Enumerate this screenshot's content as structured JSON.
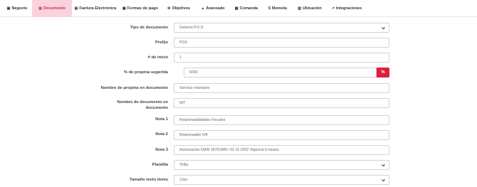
{
  "tabs": [
    {
      "icon": "▣",
      "label": "Negocio"
    },
    {
      "icon": "▤",
      "label": "Documento"
    },
    {
      "icon": "▤",
      "label": "Factura Electrónica"
    },
    {
      "icon": "▦",
      "label": "Formas de pago"
    },
    {
      "icon": "⚙",
      "label": "Objetivos"
    },
    {
      "icon": "▲",
      "label": "Avanzado"
    },
    {
      "icon": "▩",
      "label": "Comanda"
    },
    {
      "icon": "$",
      "label": "Moneda"
    },
    {
      "icon": "▥",
      "label": "Ubicación"
    },
    {
      "icon": "↗",
      "label": "Integraciones"
    }
  ],
  "form": {
    "tipo_documento": {
      "label": "Tipo de documento",
      "value": "Sistema P.O.S"
    },
    "prefijo": {
      "label": "Prefijo",
      "value": "POS"
    },
    "inicio": {
      "label": "# de inicio",
      "value": "1"
    },
    "propina": {
      "label": "% de propina sugerida",
      "value": "5000",
      "addon": "%"
    },
    "nombre_propina": {
      "label": "Nombre de propina en documento",
      "value": "Servicio voluntario"
    },
    "nombre_documento": {
      "label_line1": "Nombre de documento en",
      "label_line2": "documento",
      "value": "NIT"
    },
    "nota1": {
      "label": "Nota 1",
      "value": "Responsabilidades Fiscales"
    },
    "nota2": {
      "label": "Nota 2",
      "value": "Responsable IVA"
    },
    "nota3": {
      "label": "Nota 3",
      "value": "Autorización DIAN 18761889 / 02-11-2022 Vigencia 6 meses"
    },
    "plantilla": {
      "label": "Plantilla",
      "value": "Tirilla"
    },
    "tamano": {
      "label": "Tamaño texto items",
      "value": "12px"
    }
  }
}
